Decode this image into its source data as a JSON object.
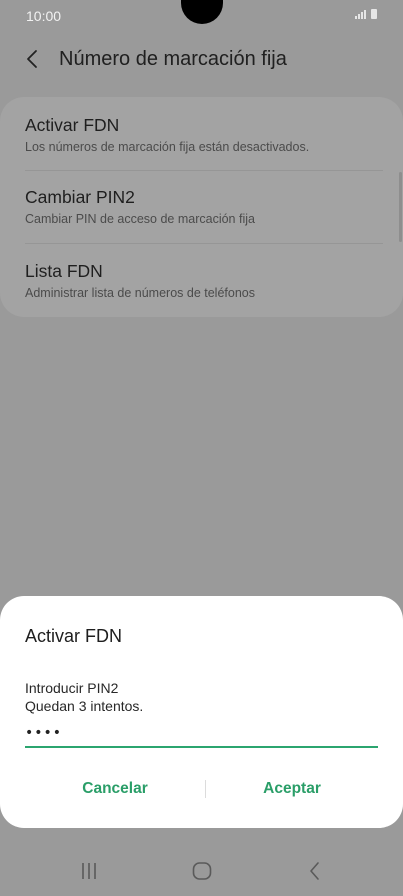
{
  "status_bar": {
    "time": "10:00"
  },
  "app_bar": {
    "title": "Número de marcación fija"
  },
  "settings": {
    "items": [
      {
        "title": "Activar FDN",
        "subtitle": "Los números de marcación fija están desactivados."
      },
      {
        "title": "Cambiar PIN2",
        "subtitle": "Cambiar PIN de acceso de marcación fija"
      },
      {
        "title": "Lista FDN",
        "subtitle": "Administrar lista de números de teléfonos"
      }
    ]
  },
  "dialog": {
    "title": "Activar FDN",
    "message_line1": "Introducir PIN2",
    "message_line2": "Quedan 3 intentos.",
    "pin_value": "••••",
    "cancel_label": "Cancelar",
    "accept_label": "Aceptar"
  },
  "colors": {
    "accent": "#2a9e68",
    "scrim": "#9a9a9a",
    "dialog_bg": "#ffffff"
  },
  "icons": {
    "back": "chevron-left-icon",
    "nav_recents": "recents-icon",
    "nav_home": "home-icon",
    "nav_back": "back-icon"
  }
}
